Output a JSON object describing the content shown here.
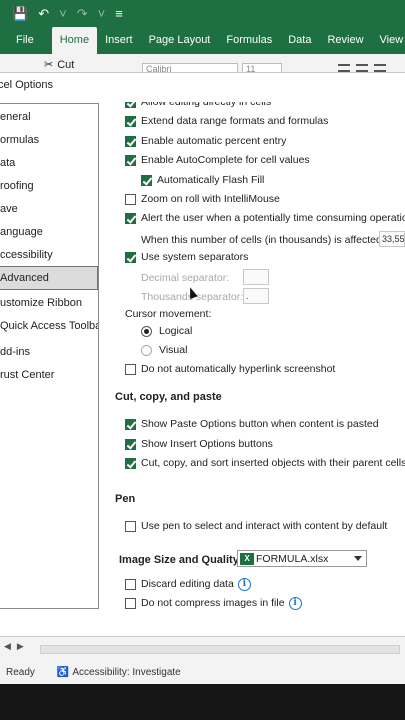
{
  "qa": {
    "save_icon": "save-icon",
    "undo_icon": "undo-icon",
    "redo_icon": "redo-icon",
    "more_icon": "more-icon"
  },
  "ribbon": {
    "tabs": [
      "File",
      "Home",
      "Insert",
      "Page Layout",
      "Formulas",
      "Data",
      "Review",
      "View"
    ],
    "active_tab": "Home",
    "cut_label": "Cut",
    "font_name": "Calibri",
    "font_size": "11"
  },
  "dialog": {
    "title": "cel Options",
    "nav": [
      "eneral",
      "ormulas",
      "ata",
      "roofing",
      "ave",
      "anguage",
      "ccessibility",
      "Advanced",
      "ustomize Ribbon",
      "Quick Access Toolbar",
      "dd-ins",
      "rust Center"
    ],
    "selected_nav": "Advanced",
    "options": {
      "partial_top": "Allow editing directly in cells",
      "extend_formats": "Extend data range formats and formulas",
      "auto_percent": "Enable automatic percent entry",
      "autocomplete": "Enable AutoComplete for cell values",
      "flash_fill": "Automatically Flash Fill",
      "zoom_roll": "Zoom on roll with IntelliMouse",
      "alert_time": "Alert the user when a potentially time consuming operation",
      "cells_label": "When this number of cells (in thousands) is affected:",
      "cells_value": "33,55",
      "system_sep": "Use system separators",
      "decimal_sep": "Decimal separator:",
      "decimal_value": "",
      "thousands_sep": "Thousands separator:",
      "thousands_value": ".",
      "cursor_movement": "Cursor movement:",
      "logical": "Logical",
      "visual": "Visual",
      "no_hyperlink": "Do not automatically hyperlink screenshot"
    },
    "sections": {
      "cut_copy_paste": "Cut, copy, and paste",
      "pen": "Pen",
      "image_size": "Image Size and Quality"
    },
    "ccp": {
      "paste_options": "Show Paste Options button when content is pasted",
      "insert_options": "Show Insert Options buttons",
      "sort_objects": "Cut, copy, and sort inserted objects with their parent cells"
    },
    "pen": {
      "use_pen": "Use pen to select and interact with content by default"
    },
    "image": {
      "file": "FORMULA.xlsx",
      "discard": "Discard editing data",
      "no_compress": "Do not compress images in file"
    }
  },
  "status": {
    "ready": "Ready",
    "accessibility": "Accessibility: Investigate"
  }
}
